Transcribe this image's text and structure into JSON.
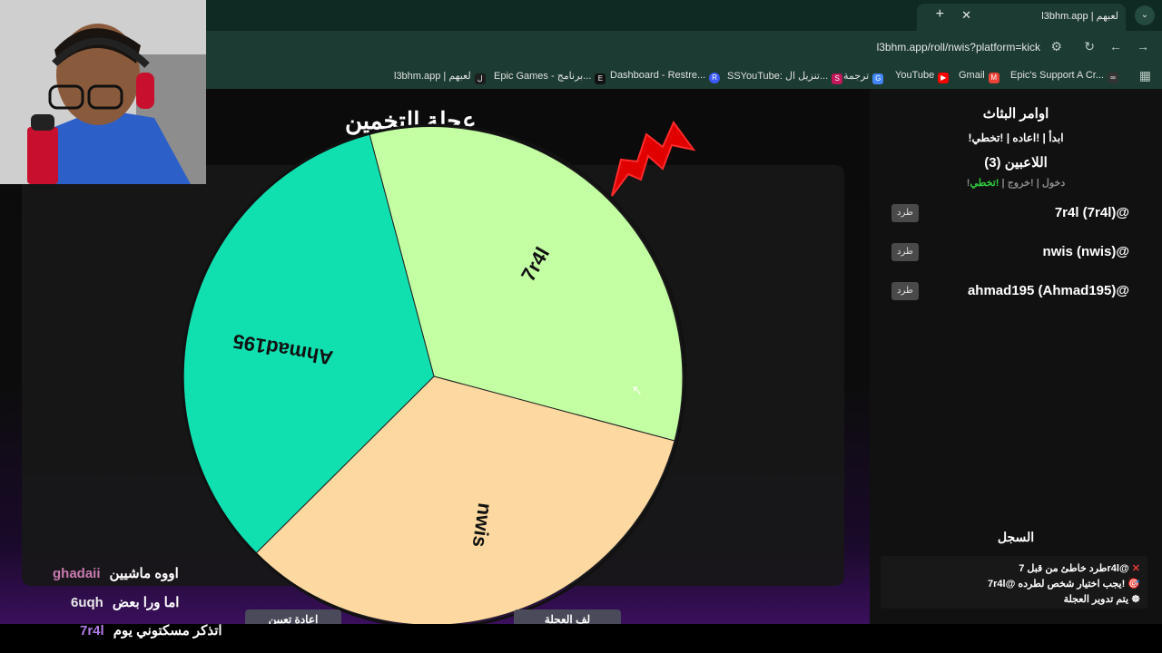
{
  "browser": {
    "tab_title": "l3bhm.app | لعبهم",
    "url": "l3bhm.app/roll/nwis?platform=kick",
    "bookmarks": [
      {
        "label": "l3bhm.app | لعبهم",
        "icon": "l3bhm-icon"
      },
      {
        "label": "Epic Games - برنامج...",
        "icon": "epic-games-icon"
      },
      {
        "label": "Dashboard - Restre...",
        "icon": "restream-icon"
      },
      {
        "label": "SSYouTube: تنزيل ال...",
        "icon": "ssyoutube-icon"
      },
      {
        "label": "ترجمة",
        "icon": "translate-icon"
      },
      {
        "label": "YouTube",
        "icon": "youtube-icon"
      },
      {
        "label": "Gmail",
        "icon": "gmail-icon"
      },
      {
        "label": "Epic's Support A Cr...",
        "icon": "link-icon"
      }
    ]
  },
  "main": {
    "wheel_title": "عجلة التخمين",
    "wheel_segments": [
      {
        "label": "7r4l",
        "color": "#c3ffa3"
      },
      {
        "label": "nwis",
        "color": "#fdd9a1"
      },
      {
        "label": "Ahmad195",
        "color": "#10e0b0"
      }
    ],
    "buttons": [
      "اعادة تعيين",
      "لف العجلة"
    ]
  },
  "sidebar": {
    "title": "اوامر البثاث",
    "commands": "!ابدأ | !اعاده | !تخطي",
    "players_heading": "اللاعبين (3)",
    "player_commands": {
      "join": "!دخول",
      "leave": "!خروج",
      "skip": "!تخطي"
    },
    "kick_label": "طرد",
    "players": [
      "7r4l (7r4l)@",
      "nwis (nwis)@",
      "ahmad195 (Ahmad195)@"
    ],
    "log_heading": "السجل",
    "log": [
      {
        "icon": "✕",
        "text": "طرد خاطئ من قبل 7r4l@"
      },
      {
        "icon": "🎯",
        "text": "7r4l@ يجب اختيار شخص لطرده!"
      },
      {
        "icon": "☸",
        "text": "يتم تدوير العجلة"
      }
    ]
  },
  "stream_chat": [
    {
      "user": "ghadaii",
      "message": "اووه ماشيين",
      "color": "#c97ab0"
    },
    {
      "user": "6uqh",
      "message": "اما ورا بعض",
      "color": "#e8e8e8"
    },
    {
      "user": "7r4l",
      "message": "اتذكر مسكتوني يوم",
      "color": "#b07be6"
    }
  ]
}
